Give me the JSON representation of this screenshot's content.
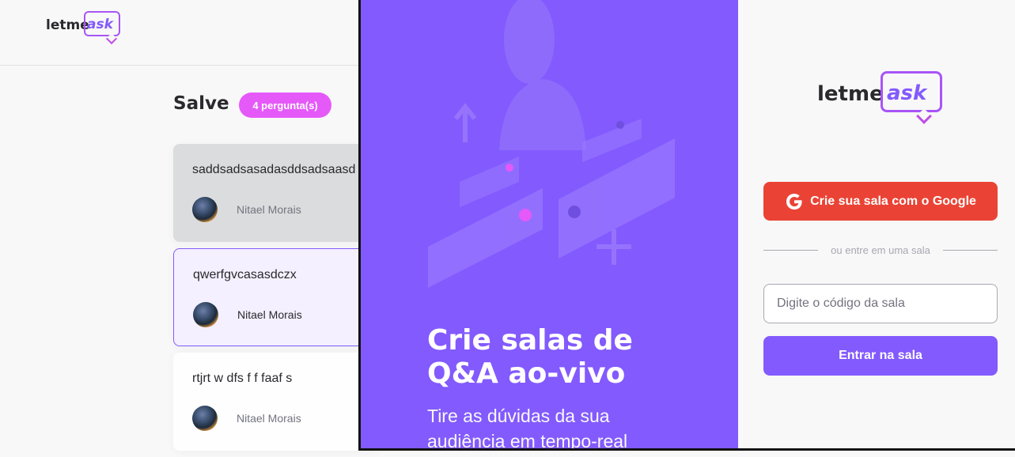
{
  "header": {
    "logo_prefix": "letme",
    "logo_suffix": "ask"
  },
  "room": {
    "title": "Salve",
    "question_count": "4 pergunta(s)",
    "questions": [
      {
        "content": "saddsadsasadasddsadsaasd",
        "author": "Nitael Morais",
        "state": "answered"
      },
      {
        "content": "qwerfgvcasasdczx",
        "author": "Nitael Morais",
        "state": "highlighted"
      },
      {
        "content": "rtjrt w dfs f f faaf s",
        "author": "Nitael Morais",
        "state": "normal"
      }
    ]
  },
  "auth": {
    "aside_title": "Crie salas de Q&A ao-vivo",
    "aside_subtitle": "Tire as dúvidas da sua audiência em tempo-real",
    "logo_prefix": "letme",
    "logo_suffix": "ask",
    "google_button": "Crie sua sala com o Google",
    "separator": "ou entre em uma sala",
    "room_code_placeholder": "Digite o código da sala",
    "enter_button": "Entrar na sala"
  },
  "colors": {
    "purple": "#835afd",
    "pink": "#e559f9",
    "google_red": "#ea4335",
    "text": "#29292e",
    "muted": "#737380"
  },
  "icons": [
    "logo-bubble-icon",
    "google-icon",
    "avatar"
  ]
}
